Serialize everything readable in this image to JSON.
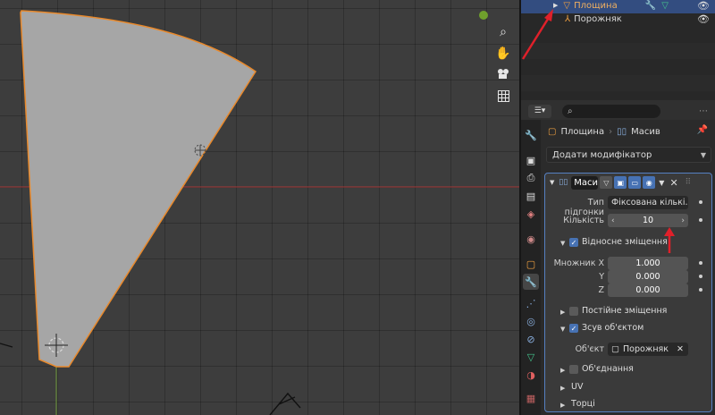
{
  "outliner": {
    "items": [
      {
        "label": "Площина",
        "selected": true
      },
      {
        "label": "Порожняк",
        "selected": false
      }
    ]
  },
  "properties": {
    "search": {
      "placeholder": ""
    },
    "breadcrumb": {
      "object": "Площина",
      "modifier": "Масив"
    },
    "add_modifier_label": "Додати модифікатор",
    "modifier": {
      "name": "Маси",
      "fit_type_label": "Тип підгонки",
      "fit_type_value": "Фіксована кількі...",
      "count_label": "Кількість",
      "count_value": "10",
      "relative_offset_label": "Відносне зміщення",
      "factor_x_label": "Множник X",
      "factor_x_value": "1.000",
      "factor_y_label": "Y",
      "factor_y_value": "0.000",
      "factor_z_label": "Z",
      "factor_z_value": "0.000",
      "constant_offset_label": "Постійне зміщення",
      "object_offset_label": "Зсув об'єктом",
      "object_label": "Об'єкт",
      "object_value": "Порожняк",
      "merge_label": "Об'єднання",
      "uv_label": "UV",
      "caps_label": "Торці"
    }
  },
  "colors": {
    "selection": "#334d80",
    "accent": "#4772b3",
    "annotation_arrow": "#e0202a",
    "outline": "#e8892c"
  },
  "icons": [
    "mesh-icon",
    "empty-icon",
    "eye-icon",
    "wrench-icon",
    "array-icon",
    "zoom-icon",
    "hand-icon",
    "camera-icon",
    "grid-icon",
    "search-icon",
    "pin-icon"
  ]
}
